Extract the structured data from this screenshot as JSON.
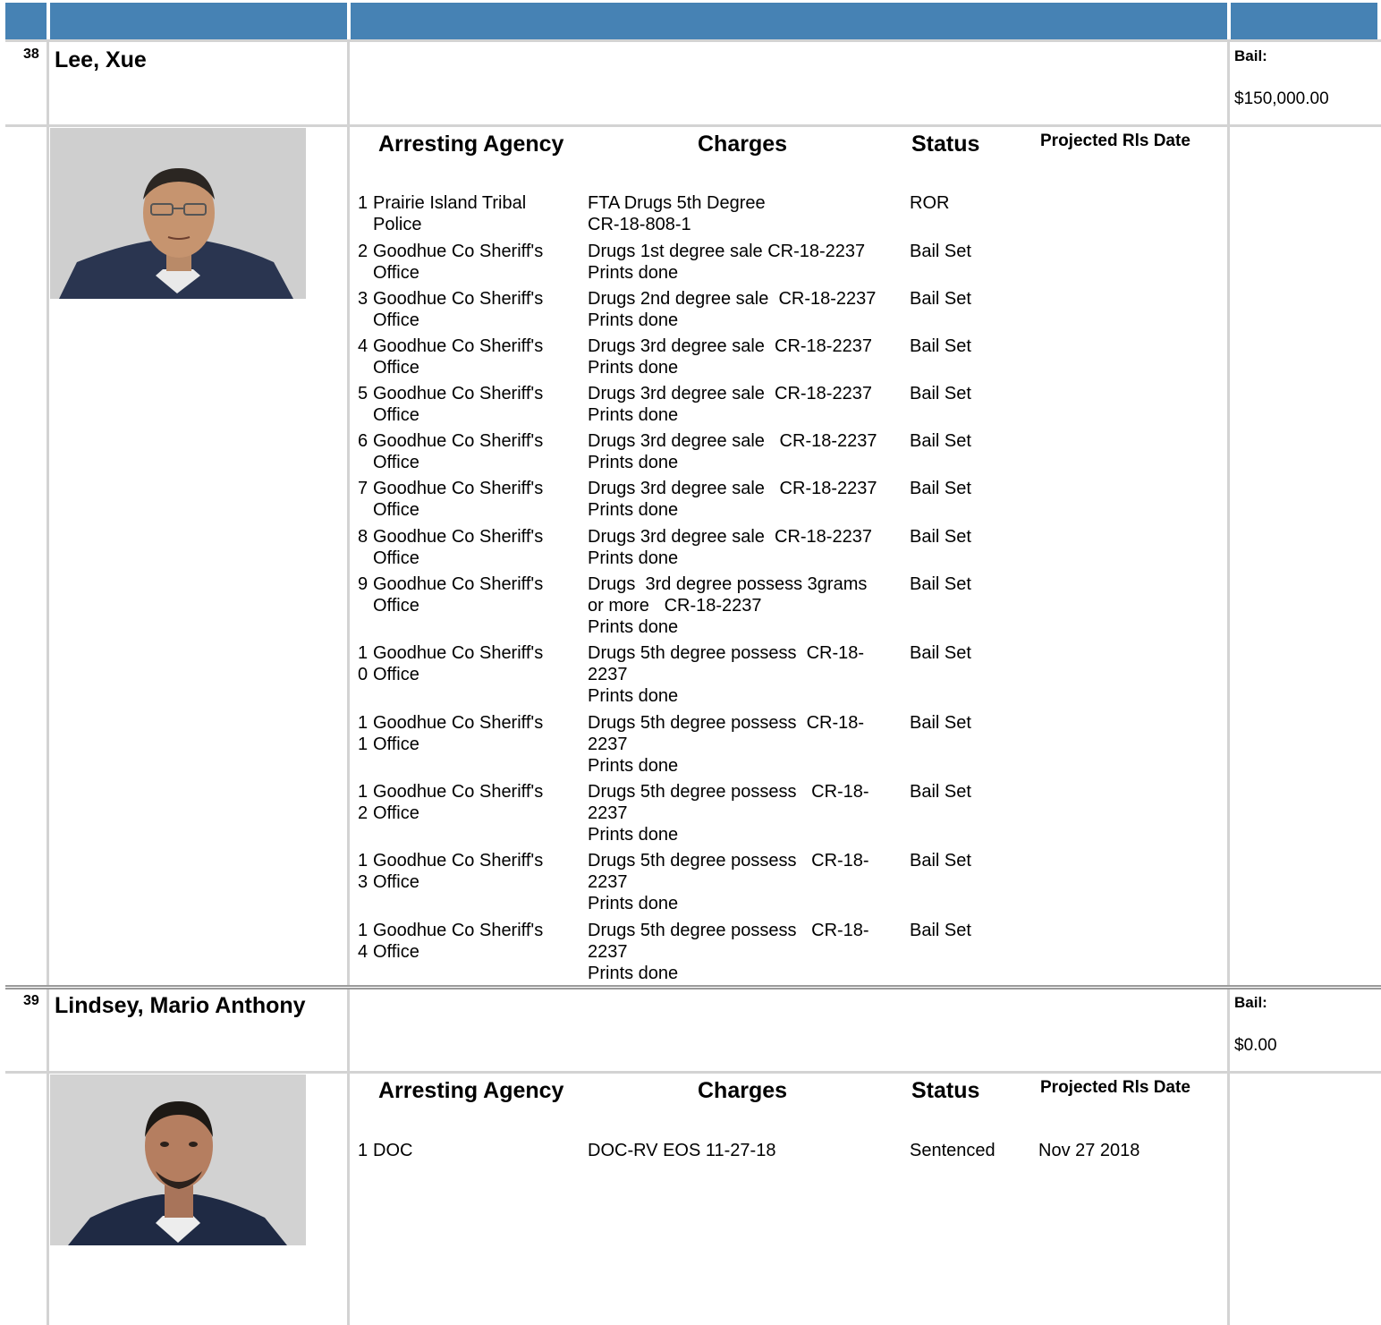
{
  "inmates": [
    {
      "number": "38",
      "name": "Lee, Xue",
      "bail_label": "Bail:",
      "bail_amount": "$150,000.00",
      "headers": {
        "agency": "Arresting Agency",
        "charges": "Charges",
        "status": "Status",
        "rls": "Projected Rls Date"
      },
      "charges": [
        {
          "idx": "1",
          "agency": "Prairie Island Tribal Police",
          "charge": "FTA Drugs 5th Degree\nCR-18-808-1",
          "status": "ROR",
          "rls": ""
        },
        {
          "idx": "2",
          "agency": "Goodhue Co Sheriff's Office",
          "charge": "Drugs 1st degree sale CR-18-2237\nPrints done",
          "status": "Bail Set",
          "rls": ""
        },
        {
          "idx": "3",
          "agency": "Goodhue Co Sheriff's Office",
          "charge": "Drugs 2nd degree sale  CR-18-2237\nPrints done",
          "status": "Bail Set",
          "rls": ""
        },
        {
          "idx": "4",
          "agency": "Goodhue Co Sheriff's Office",
          "charge": "Drugs 3rd degree sale  CR-18-2237\nPrints done",
          "status": "Bail Set",
          "rls": ""
        },
        {
          "idx": "5",
          "agency": "Goodhue Co Sheriff's Office",
          "charge": "Drugs 3rd degree sale  CR-18-2237\nPrints done",
          "status": "Bail Set",
          "rls": ""
        },
        {
          "idx": "6",
          "agency": "Goodhue Co Sheriff's Office",
          "charge": "Drugs 3rd degree sale   CR-18-2237\nPrints done",
          "status": "Bail Set",
          "rls": ""
        },
        {
          "idx": "7",
          "agency": "Goodhue Co Sheriff's Office",
          "charge": "Drugs 3rd degree sale   CR-18-2237\nPrints done",
          "status": "Bail Set",
          "rls": ""
        },
        {
          "idx": "8",
          "agency": "Goodhue Co Sheriff's Office",
          "charge": "Drugs 3rd degree sale  CR-18-2237\nPrints done",
          "status": "Bail Set",
          "rls": ""
        },
        {
          "idx": "9",
          "agency": "Goodhue Co Sheriff's Office",
          "charge": "Drugs  3rd degree possess 3grams\nor more   CR-18-2237\nPrints done",
          "status": "Bail Set",
          "rls": ""
        },
        {
          "idx": "1\n0",
          "agency": "Goodhue Co Sheriff's Office",
          "charge": "Drugs 5th degree possess  CR-18-\n2237\nPrints done",
          "status": "Bail Set",
          "rls": ""
        },
        {
          "idx": "1\n1",
          "agency": "Goodhue Co Sheriff's Office",
          "charge": "Drugs 5th degree possess  CR-18-\n2237\nPrints done",
          "status": "Bail Set",
          "rls": ""
        },
        {
          "idx": "1\n2",
          "agency": "Goodhue Co Sheriff's Office",
          "charge": "Drugs 5th degree possess   CR-18-\n2237\nPrints done",
          "status": "Bail Set",
          "rls": ""
        },
        {
          "idx": "1\n3",
          "agency": "Goodhue Co Sheriff's Office",
          "charge": "Drugs 5th degree possess   CR-18-\n2237\nPrints done",
          "status": "Bail Set",
          "rls": ""
        },
        {
          "idx": "1\n4",
          "agency": "Goodhue Co Sheriff's Office",
          "charge": "Drugs 5th degree possess   CR-18-\n2237\nPrints done",
          "status": "Bail Set",
          "rls": ""
        }
      ]
    },
    {
      "number": "39",
      "name": "Lindsey, Mario Anthony",
      "bail_label": "Bail:",
      "bail_amount": "$0.00",
      "headers": {
        "agency": "Arresting Agency",
        "charges": "Charges",
        "status": "Status",
        "rls": "Projected Rls Date"
      },
      "charges": [
        {
          "idx": "1",
          "agency": "DOC",
          "charge": "DOC-RV EOS 11-27-18",
          "status": "Sentenced",
          "rls": "Nov 27 2018"
        }
      ]
    }
  ]
}
